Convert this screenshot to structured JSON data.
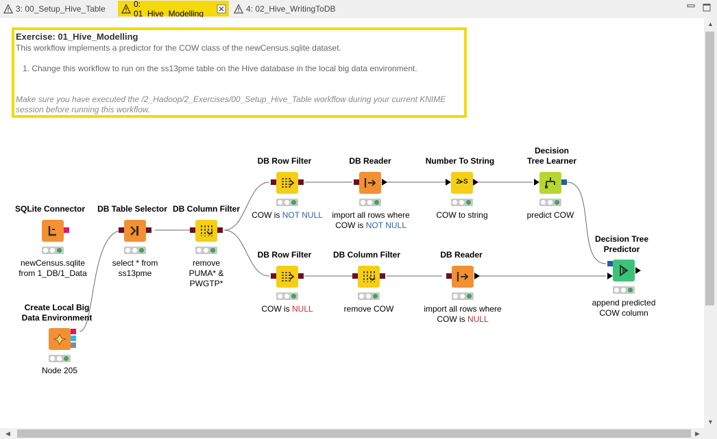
{
  "tabs": [
    {
      "label": "3: 00_Setup_Hive_Table",
      "active": false
    },
    {
      "label": "0: 01_Hive_Modelling",
      "active": true
    },
    {
      "label": "4: 02_Hive_WritingToDB",
      "active": false
    }
  ],
  "annotation": {
    "title": "Exercise: 01_Hive_Modelling",
    "line1": "This workflow implements a predictor for the COW class of the newCensus.sqlite dataset.",
    "step1": "1. Change this workflow to run on the ss13pme table on the Hive database in the local big data environment.",
    "note": "Make sure you have executed the /2_Hadoop/2_Exercises/00_Setup_Hive_Table workflow during your current KNIME session before running this workflow."
  },
  "nodes": {
    "sqlite": {
      "title": "SQLite Connector",
      "label1": "newCensus.sqlite",
      "label2": "from 1_DB/1_Data"
    },
    "table_selector": {
      "title": "DB Table Selector",
      "label1": "select * from",
      "label2": "ss13pme"
    },
    "column_filter1": {
      "title": "DB Column Filter",
      "label1": "remove",
      "label2": "PUMA* &",
      "label3": "PWGTP*"
    },
    "local_bigdata": {
      "title1": "Create Local Big",
      "title2": "Data Environment",
      "label": "Node 205"
    },
    "row_filter_top": {
      "title": "DB Row Filter",
      "label_prefix": "COW is ",
      "label_value": "NOT NULL"
    },
    "reader_top": {
      "title": "DB Reader",
      "label1": "import all rows where",
      "label2_prefix": "COW is ",
      "label2_value": "NOT NULL"
    },
    "num_to_string": {
      "title": "Number To String",
      "label": "COW to string",
      "icon_text": "2▸S"
    },
    "tree_learner": {
      "title1": "Decision",
      "title2": "Tree Learner",
      "label": "predict COW"
    },
    "row_filter_bottom": {
      "title": "DB Row Filter",
      "label_prefix": "COW is ",
      "label_value": "NULL"
    },
    "column_filter2": {
      "title": "DB Column Filter",
      "label": "remove COW"
    },
    "reader_bottom": {
      "title": "DB Reader",
      "label1": "import all rows where",
      "label2_prefix": "COW is ",
      "label2_value": "NULL"
    },
    "tree_predictor": {
      "title1": "Decision Tree",
      "title2": "Predictor",
      "label1": "append predicted",
      "label2": "COW column"
    }
  },
  "colors": {
    "active_tab": "#f5d90a",
    "annotation_border": "#f5d90a",
    "db_port": "#6b0f23",
    "model_port": "#1f5fa8",
    "node_orange": "#f39033",
    "node_yellow": "#f5cf15",
    "node_lime": "#b9d531",
    "node_green": "#3ec27a",
    "highlight_blue": "#2a62b3",
    "highlight_red": "#d12929"
  }
}
